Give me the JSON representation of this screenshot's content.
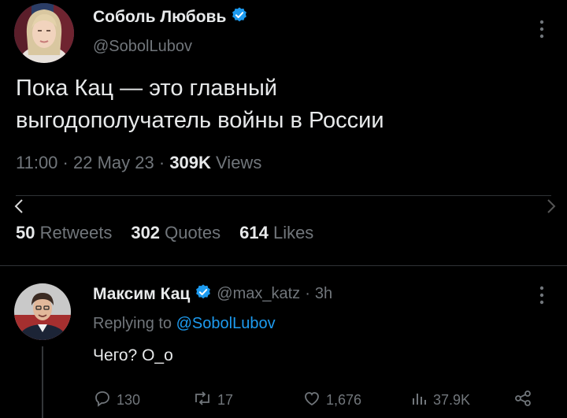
{
  "original_tweet": {
    "display_name": "Соболь Любовь",
    "handle": "@SobolLubov",
    "text_line1": "Пока Кац — это главный",
    "text_line2": "выгодополучатель войны в России",
    "time": "11:00",
    "date": "22 May 23",
    "views_count": "309K",
    "views_label": "Views",
    "retweets_count": "50",
    "retweets_label": "Retweets",
    "quotes_count": "302",
    "quotes_label": "Quotes",
    "likes_count": "614",
    "likes_label": "Likes"
  },
  "reply": {
    "display_name": "Максим Кац",
    "handle": "@max_katz",
    "age": "3h",
    "replying_to_label": "Replying to",
    "replying_to_handle": "@SobolLubov",
    "text": "Чего? О_о",
    "replies": "130",
    "retweets": "17",
    "likes": "1,676",
    "views": "37.9K"
  },
  "colors": {
    "background": "#000000",
    "text": "#e7e9ea",
    "secondary": "#71767b",
    "verified": "#1d9bf0",
    "divider": "#2f3336"
  },
  "icons": [
    "verified-badge-icon",
    "more-icon",
    "chevron-left-icon",
    "chevron-right-icon",
    "reply-icon",
    "retweet-icon",
    "like-icon",
    "views-icon",
    "share-icon"
  ]
}
